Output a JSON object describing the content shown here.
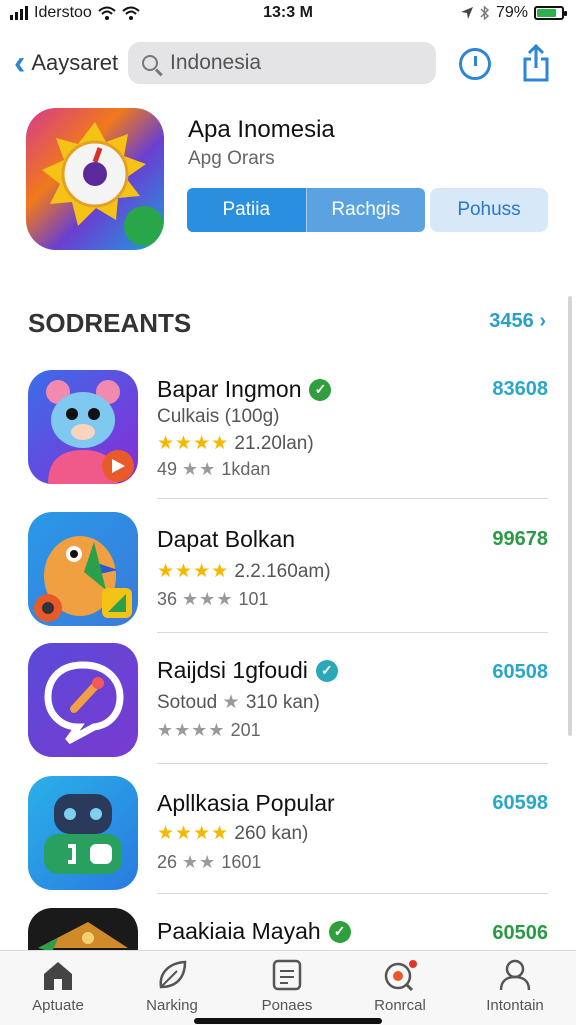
{
  "status": {
    "carrier": "Iderstoo",
    "time": "13:3 M",
    "battery": "79%",
    "battery_level": 0.79
  },
  "nav": {
    "back_label": "Aaysaret",
    "search_value": "Indonesia"
  },
  "hero": {
    "title": "Apa Inomesia",
    "subtitle": "Apg Orars",
    "seg_labels": [
      "Patiia",
      "Rachgis"
    ],
    "button_label": "Pohuss"
  },
  "section": {
    "title": "SODREANTS",
    "link": "3456"
  },
  "apps": [
    {
      "name": "Bapar Ingmon",
      "line2_text": "Culkais (100g)",
      "line2_stars": "",
      "line2_rating": "",
      "rating": "21.20lan)",
      "line3_prefix": "49",
      "line3_text": "1kdan",
      "price": "83608",
      "price_color": "#2aa7c8",
      "verified_color": "#2f9e3c"
    },
    {
      "name": "Dapat Bolkan",
      "line2_text": "",
      "line2_stars": "",
      "line2_rating": "",
      "rating": "2.2.160am)",
      "line3_prefix": "36",
      "line3_text": "101",
      "price": "99678",
      "price_color": "#2a9a45",
      "verified_color": ""
    },
    {
      "name": "Raijdsi 1gfoudi",
      "line2_text": "Sotoud",
      "line2_stars": "★",
      "line2_rating": "310 kan)",
      "rating": "",
      "line3_prefix": "",
      "line3_text": "201",
      "price": "60508",
      "price_color": "#2aa7c8",
      "verified_color": "#2aa7b8"
    },
    {
      "name": "Apllkasia Popular",
      "line2_text": "",
      "line2_stars": "",
      "line2_rating": "",
      "rating": "260 kan)",
      "line3_prefix": "26",
      "line3_text": "1601",
      "price": "60598",
      "price_color": "#2aa7c8",
      "verified_color": ""
    },
    {
      "name": "Paakiaia Mayah",
      "line2_text": "",
      "line2_stars": "",
      "line2_rating": "",
      "rating": "",
      "line3_prefix": "",
      "line3_text": "",
      "price": "60506",
      "price_color": "#2a9a45",
      "verified_color": "#2f9e3c"
    }
  ],
  "tabs": [
    {
      "label": "Aptuate",
      "icon": "home-icon"
    },
    {
      "label": "Narking",
      "icon": "leaf-icon"
    },
    {
      "label": "Ponaes",
      "icon": "document-icon"
    },
    {
      "label": "Ronrcal",
      "icon": "search-badge-icon"
    },
    {
      "label": "Intontain",
      "icon": "person-icon"
    }
  ]
}
